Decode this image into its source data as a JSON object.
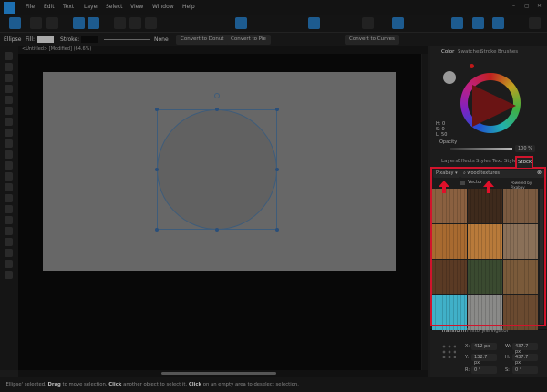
{
  "menu": [
    "File",
    "Edit",
    "Text",
    "Layer",
    "Select",
    "View",
    "Window",
    "Help"
  ],
  "context": {
    "shape": "Ellipse",
    "fill_label": "Fill:",
    "stroke_label": "Stroke:",
    "stroke_value": "None",
    "buttons": [
      "Convert to Donut",
      "Convert to Pie",
      "Convert to Curves"
    ]
  },
  "document_tab": "<Untitled> [Modified] (64.6%)",
  "color_panel": {
    "tabs": [
      "Color",
      "Swatches",
      "Stroke",
      "Brushes"
    ],
    "h": "H: 0",
    "s": "S: 0",
    "l": "L: 50",
    "opacity_label": "Opacity",
    "opacity_value": "100 %"
  },
  "stock_panel": {
    "tabs": [
      "Layers",
      "Effects",
      "Styles",
      "Text Styles",
      "Stock"
    ],
    "provider": "Pixabay",
    "search_value": "wood textures",
    "vector_label": "Vector",
    "powered_by": "Powered by",
    "powered_brand": "Pixabay",
    "thumbnails": [
      "#8a6040",
      "#3e2a1c",
      "#7a5a40",
      "#a86a30",
      "#b87a3a",
      "#8a7058",
      "#5a3a24",
      "#3a4a30",
      "#7a5a3a",
      "#40b0c8",
      "#8a8a88",
      "#6a4a30"
    ]
  },
  "transform_panel": {
    "tabs": [
      "Transform",
      "History",
      "Navigator"
    ],
    "x": "412 px",
    "y": "132.7 px",
    "w": "437.7 px",
    "h": "437.7 px",
    "r": "0 °",
    "s": "0 °"
  },
  "status": {
    "p1": "'Ellipse' selected. ",
    "b1": "Drag",
    "p2": " to move selection. ",
    "b2": "Click",
    "p3": " another object to select it. ",
    "b3": "Click",
    "p4": " on an empty area to deselect selection."
  },
  "colors": {
    "accent": "#1d6fb0",
    "highlight": "#d0142c"
  }
}
